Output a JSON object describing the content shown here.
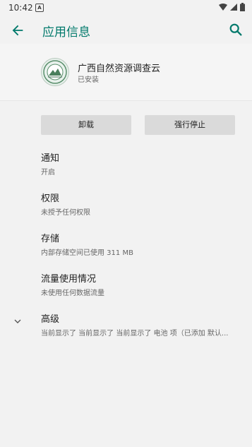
{
  "status_bar": {
    "time": "10:42",
    "notification_icon": "A"
  },
  "appbar": {
    "title": "应用信息"
  },
  "app": {
    "name": "广西自然资源调查云",
    "status": "已安装"
  },
  "buttons": {
    "uninstall": "卸载",
    "force_stop": "强行停止"
  },
  "items": [
    {
      "title": "通知",
      "subtitle": "开启"
    },
    {
      "title": "权限",
      "subtitle": "未授予任何权限"
    },
    {
      "title": "存储",
      "subtitle": "内部存储空间已使用 311 MB"
    },
    {
      "title": "流量使用情况",
      "subtitle": "未使用任何数据流量"
    },
    {
      "title": "高级",
      "subtitle": "当前显示了 当前显示了 当前显示了 电池 项（已添加 默认..."
    }
  ],
  "colors": {
    "accent": "#00796b",
    "background": "#f2f2f2"
  },
  "icons": [
    "back-icon",
    "search-icon",
    "wifi-icon",
    "signal-icon",
    "battery-icon",
    "chevron-down-icon"
  ]
}
